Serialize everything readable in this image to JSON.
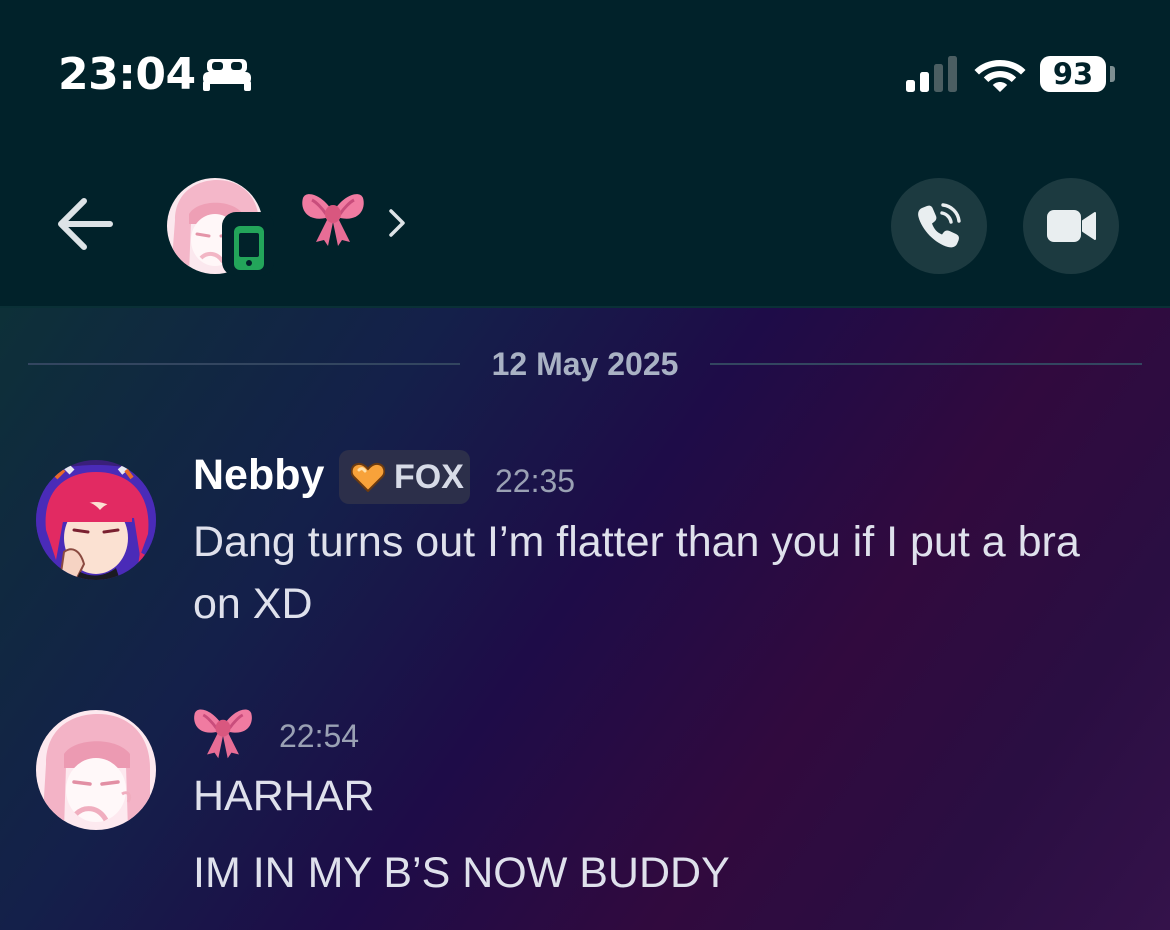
{
  "status_bar": {
    "time": "23:04",
    "focus_icon": "bed-icon",
    "signal_icon": "cellular-signal-icon",
    "wifi_icon": "wifi-icon",
    "battery_level": "93"
  },
  "header": {
    "back_icon": "arrow-left-icon",
    "contact_name_emoji": "🎀",
    "device_status": "mobile-online",
    "chevron_icon": "chevron-right-icon",
    "call_icon": "phone-call-icon",
    "video_icon": "video-camera-icon"
  },
  "chat": {
    "date_divider": "12 May 2025",
    "messages": [
      {
        "author": "Nebby",
        "tag": "FOX",
        "tag_icon": "orange-heart-icon",
        "time": "22:35",
        "lines": [
          "Dang turns out I’m flatter than you if I put a bra on XD"
        ]
      },
      {
        "author_emoji": "🎀",
        "time": "22:54",
        "lines": [
          "HARHAR",
          "IM IN MY B’S NOW BUDDY"
        ]
      }
    ]
  },
  "colors": {
    "header_bg": "#01222a",
    "text_primary": "#ffffff",
    "text_message": "#dfe1ec",
    "text_muted": "#9aa1b4",
    "status_online": "#23a55a",
    "bow_pink": "#f27aa2"
  }
}
